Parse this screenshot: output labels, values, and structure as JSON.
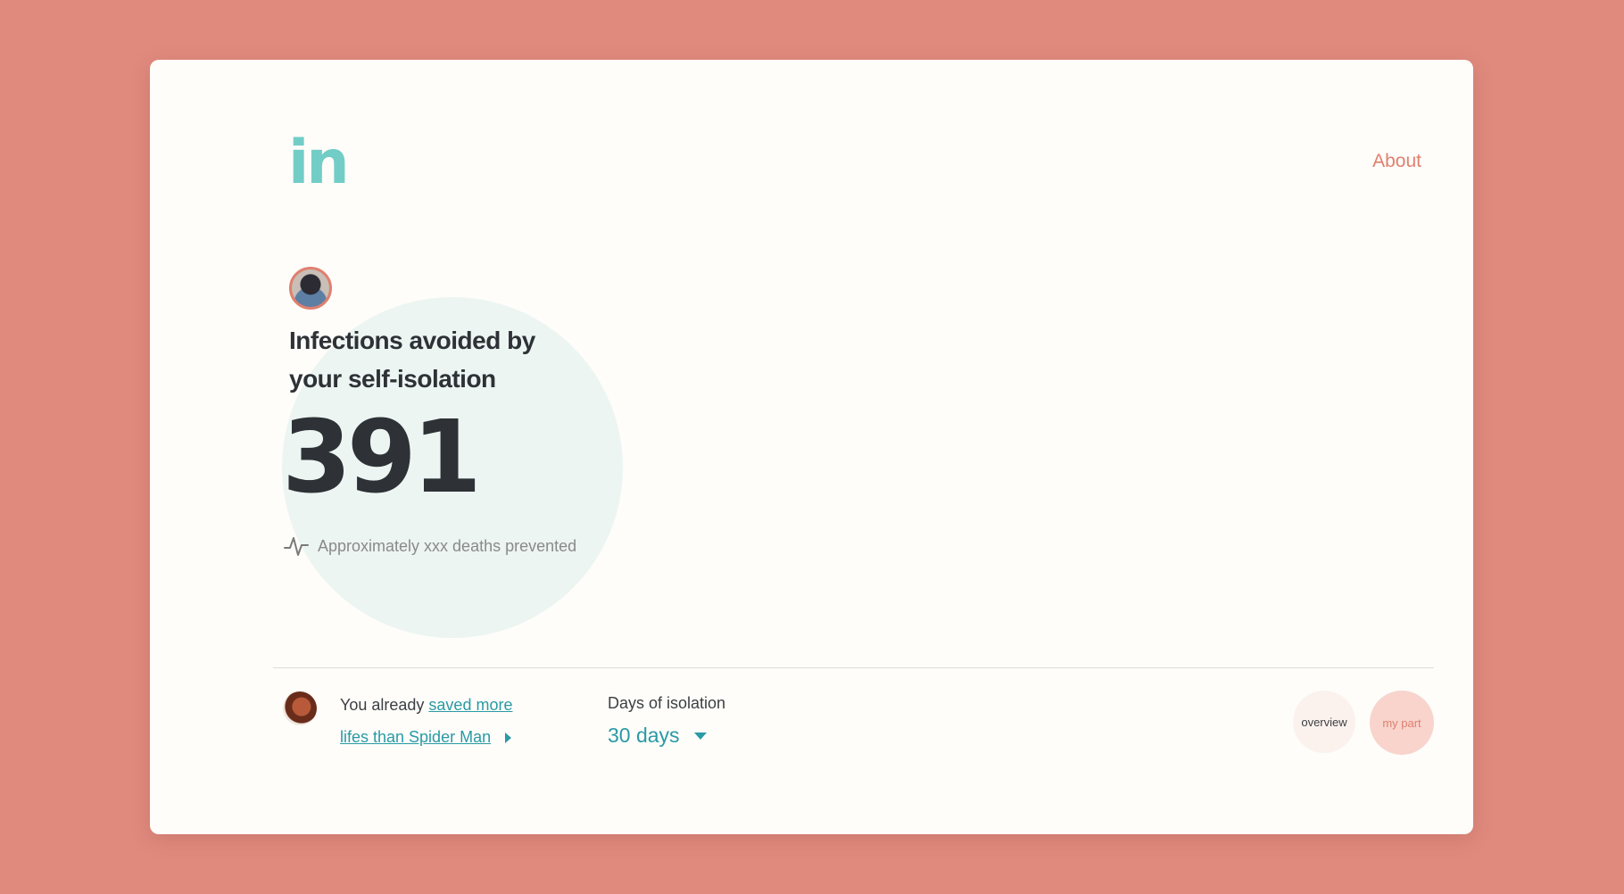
{
  "header": {
    "logo_text": "in",
    "about_label": "About"
  },
  "hero": {
    "title": "Infections avoided by your self-isolation",
    "infections_avoided": "391",
    "deaths_text": "Approximately xxx deaths prevented"
  },
  "footer": {
    "saved_prefix": "You already ",
    "saved_link": "saved more lifes than Spider Man",
    "days_label": "Days of isolation",
    "days_value": "30 days"
  },
  "nav": {
    "overview_label": "overview",
    "mypart_label": "my part"
  },
  "colors": {
    "background": "#e08a7e",
    "card": "#fefdf9",
    "accent_teal": "#2a9aa6",
    "logo_teal": "#72cdc7",
    "accent_coral": "#e0806f",
    "circle": "#ecf5f2"
  }
}
